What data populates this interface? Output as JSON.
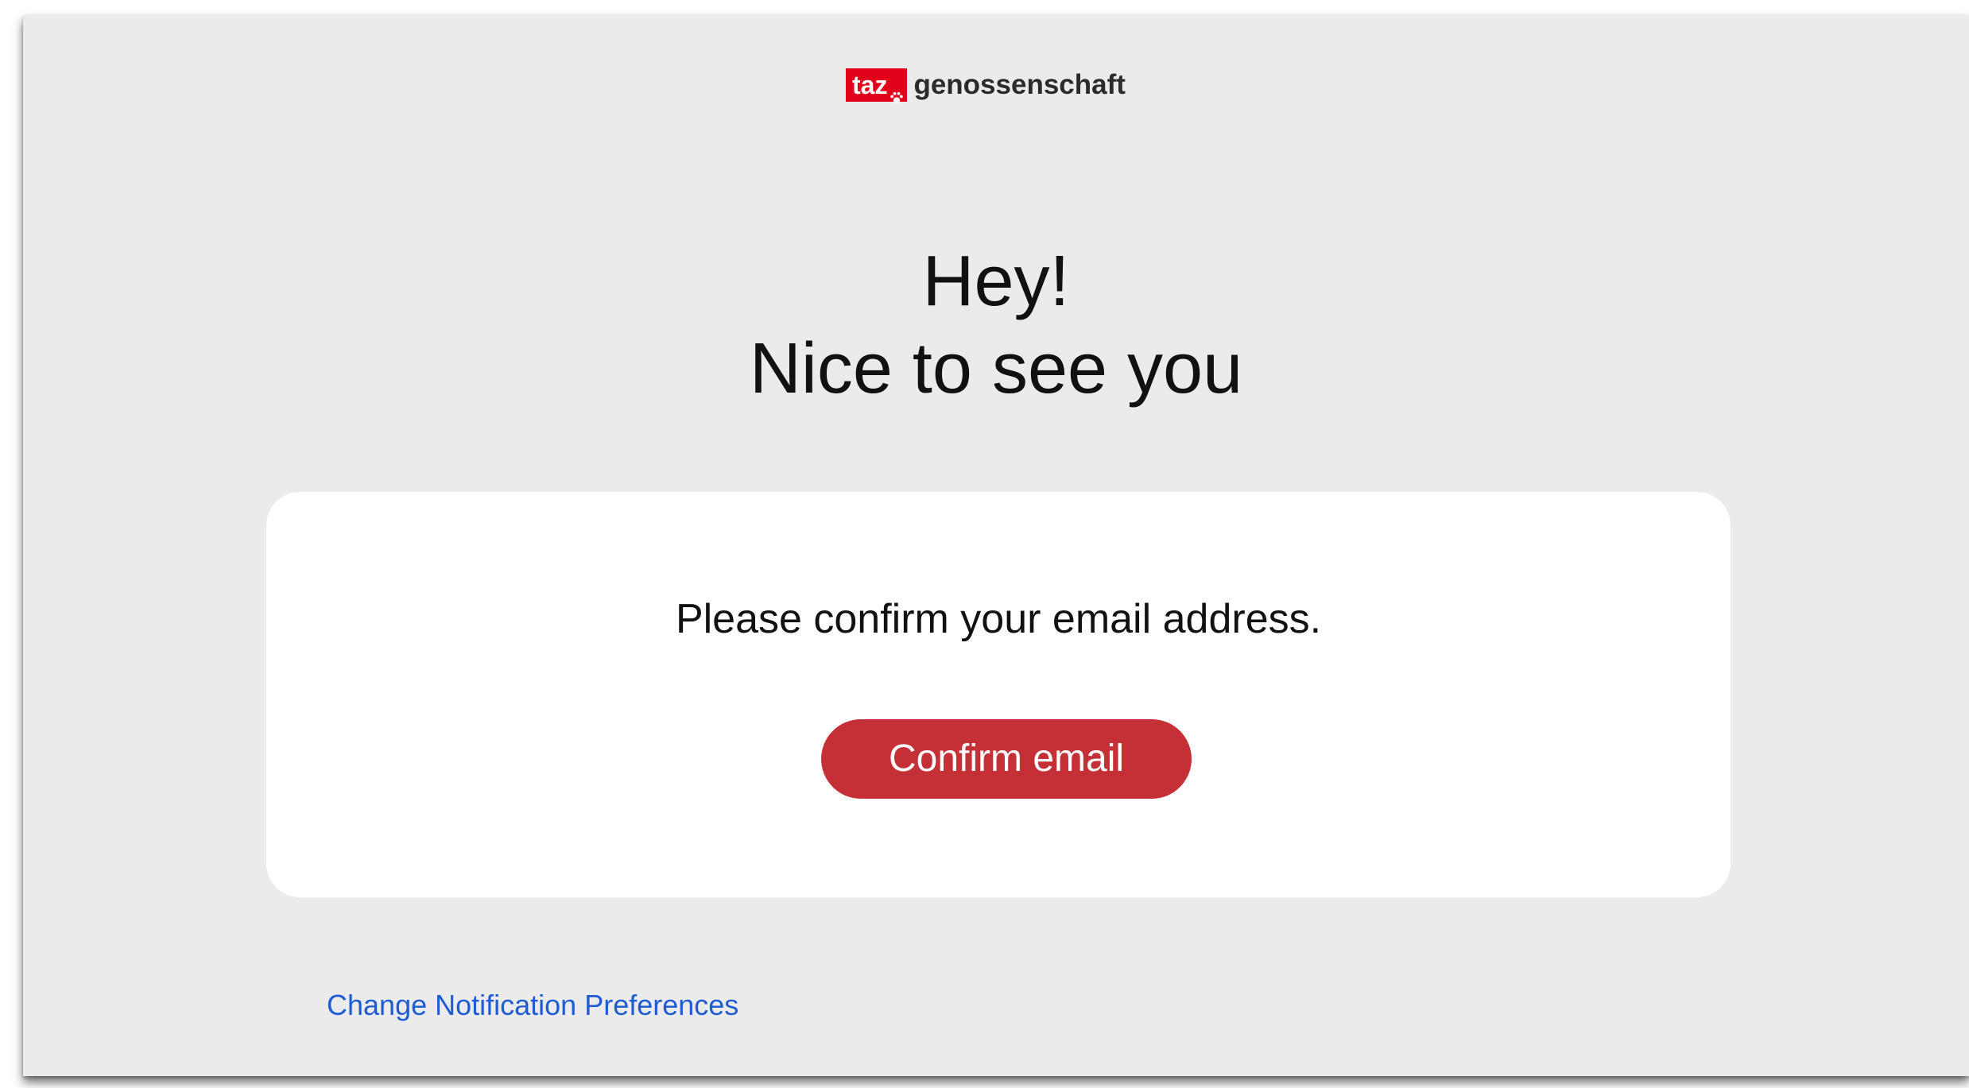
{
  "brand": {
    "badge_text": "taz",
    "wordmark": "genossenschaft",
    "badge_color": "#e3001b",
    "paw_icon": "paw-icon"
  },
  "headline": {
    "line1": "Hey!",
    "line2": "Nice to see you"
  },
  "card": {
    "message": "Please confirm your email address.",
    "confirm_label": "Confirm email",
    "button_color": "#c52f36"
  },
  "footer": {
    "preferences_link": "Change Notification Preferences",
    "link_color": "#1f5bd1"
  },
  "colors": {
    "background": "#ebebeb",
    "card": "#ffffff"
  }
}
